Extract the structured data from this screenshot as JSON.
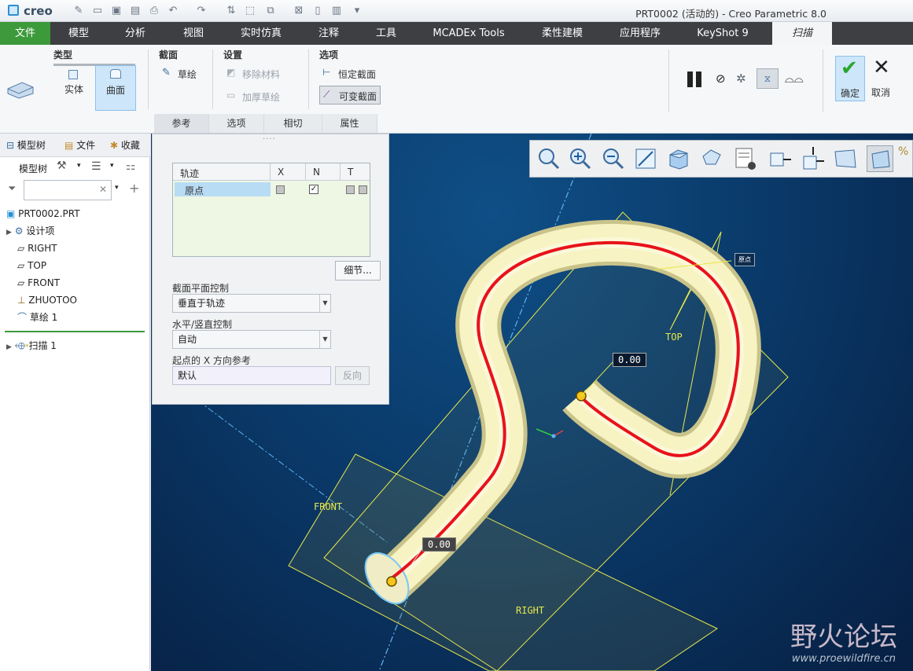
{
  "app": {
    "logo": "creo",
    "window_title": "PRT0002 (活动的) - Creo Parametric 8.0"
  },
  "menu": {
    "tabs": [
      "文件",
      "模型",
      "分析",
      "视图",
      "实时仿真",
      "注释",
      "工具",
      "MCADEx Tools",
      "柔性建模",
      "应用程序",
      "KeyShot 9",
      "扫描"
    ]
  },
  "ribbon": {
    "type_group": {
      "title": "类型",
      "solid": "实体",
      "surface": "曲面"
    },
    "section_group": {
      "title": "截面",
      "sketch": "草绘"
    },
    "settings_group": {
      "title": "设置",
      "remove_material": "移除材料",
      "thicken_sketch": "加厚草绘"
    },
    "options_group": {
      "title": "选项",
      "constant_section": "恒定截面",
      "variable_section": "可变截面"
    },
    "ok": "确定",
    "cancel": "取消",
    "subtabs": [
      "参考",
      "选项",
      "相切",
      "属性"
    ]
  },
  "left_panel": {
    "tabs": [
      "模型树",
      "文件",
      "收藏"
    ],
    "toolbar_label": "模型树",
    "search_placeholder": "",
    "tree": [
      "PRT0002.PRT",
      "设计项",
      "RIGHT",
      "TOP",
      "FRONT",
      "ZHUOTOO",
      "草绘 1",
      "扫描 1"
    ]
  },
  "ref_panel": {
    "table_headers": [
      "轨迹",
      "X",
      "N",
      "T"
    ],
    "row_name": "原点",
    "detail_button": "细节...",
    "section_plane_label": "截面平面控制",
    "section_plane_value": "垂直于轨迹",
    "hv_label": "水平/竖直控制",
    "hv_value": "自动",
    "xref_label": "起点的 X 方向参考",
    "xref_value": "默认",
    "flip_button": "反向"
  },
  "viewport": {
    "label_origin": "原点",
    "label_top": "TOP",
    "label_front": "FRONT",
    "label_right": "RIGHT",
    "dim1": "0.00",
    "dim2": "0.00",
    "watermark": "野火论坛",
    "watermark_url": "www.proewildfire.cn"
  },
  "colors": {
    "file_tab": "#3c9a3a",
    "trajectory": "#e8121b",
    "tube": "#f7f3c2",
    "ok_green": "#2aa52f"
  }
}
